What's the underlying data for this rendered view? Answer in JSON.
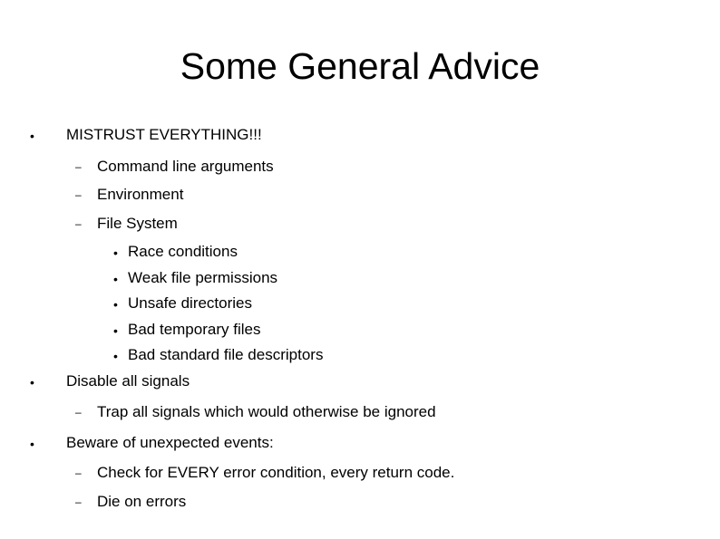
{
  "slide": {
    "title": "Some General Advice",
    "items": [
      {
        "level": 1,
        "marker": "•",
        "text": "MISTRUST EVERYTHING!!!"
      },
      {
        "level": 2,
        "marker": "–",
        "text": "Command line arguments"
      },
      {
        "level": 2,
        "marker": "–",
        "text": "Environment"
      },
      {
        "level": 2,
        "marker": "–",
        "text": "File System"
      },
      {
        "level": 3,
        "marker": "•",
        "text": "Race conditions"
      },
      {
        "level": 3,
        "marker": "•",
        "text": "Weak file permissions"
      },
      {
        "level": 3,
        "marker": "•",
        "text": "Unsafe directories"
      },
      {
        "level": 3,
        "marker": "•",
        "text": "Bad temporary files"
      },
      {
        "level": 3,
        "marker": "•",
        "text": "Bad standard file descriptors"
      },
      {
        "level": 1,
        "marker": "•",
        "text": "Disable all signals"
      },
      {
        "level": 2,
        "marker": "–",
        "text": "Trap all signals which would otherwise be ignored"
      },
      {
        "level": 1,
        "marker": "•",
        "text": "Beware of unexpected events:"
      },
      {
        "level": 2,
        "marker": "–",
        "text": "Check for EVERY error condition, every return code."
      },
      {
        "level": 2,
        "marker": "–",
        "text": "Die on errors"
      }
    ]
  }
}
